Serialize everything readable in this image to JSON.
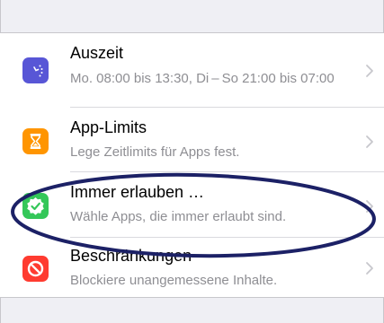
{
  "settings": {
    "rows": [
      {
        "title": "Auszeit",
        "subtitle": "Mo. 08:00 bis 13:30, Di – So 21:00 bis 07:00",
        "icon": "downtime-moon-icon",
        "icon_color": "#5856d6"
      },
      {
        "title": "App-Limits",
        "subtitle": "Lege Zeitlimits für Apps fest.",
        "icon": "hourglass-icon",
        "icon_color": "#ff9500"
      },
      {
        "title": "Immer erlauben …",
        "subtitle": "Wähle Apps, die immer erlaubt sind.",
        "icon": "checkmark-badge-icon",
        "icon_color": "#34c759"
      },
      {
        "title": "Beschränkungen",
        "subtitle": "Blockiere unangemessene Inhalte.",
        "icon": "no-entry-icon",
        "icon_color": "#ff3b30"
      }
    ]
  },
  "annotation": {
    "highlight_color": "#1c2166"
  },
  "colors": {
    "background": "#efeff4",
    "cell": "#ffffff",
    "subtitle": "#8e8e93",
    "chevron": "#c7c7cc"
  }
}
